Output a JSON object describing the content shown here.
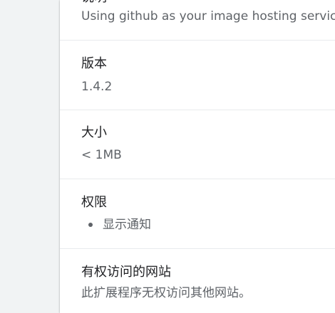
{
  "description": {
    "label": "说明",
    "value": "Using github as your image hosting service"
  },
  "version": {
    "label": "版本",
    "value": "1.4.2"
  },
  "size": {
    "label": "大小",
    "value": "< 1MB"
  },
  "permissions": {
    "label": "权限",
    "items": [
      "显示通知"
    ]
  },
  "site_access": {
    "label": "有权访问的网站",
    "value": "此扩展程序无权访问其他网站。"
  },
  "colors": {
    "page_background": "#f1f3f4",
    "card_background": "#ffffff",
    "primary_text": "#202124",
    "secondary_text": "#5f6368",
    "divider": "#e8eaed"
  }
}
